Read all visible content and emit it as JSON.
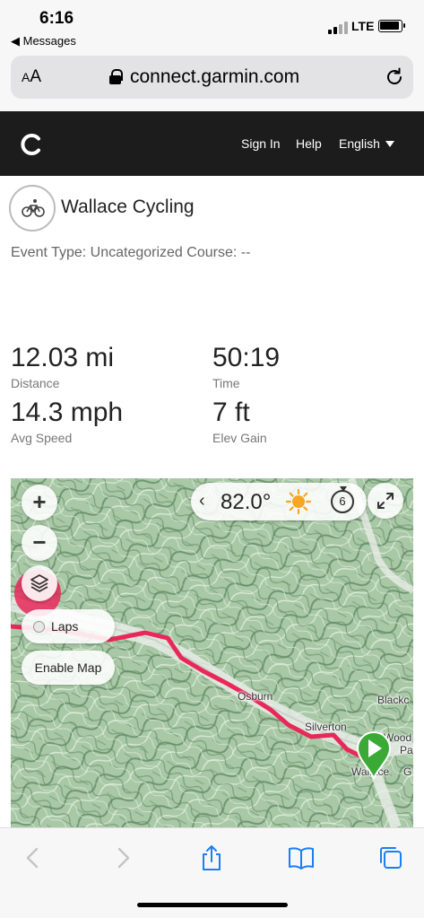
{
  "status_bar": {
    "time": "6:16",
    "back_app": "◀ Messages",
    "network": "LTE"
  },
  "browser": {
    "text_size_label": "AA",
    "domain": "connect.garmin.com",
    "icons": [
      "lock-icon",
      "reload-icon",
      "back-icon",
      "forward-icon",
      "share-icon",
      "bookmarks-icon",
      "tabs-icon"
    ]
  },
  "nav": {
    "signin": "Sign In",
    "help": "Help",
    "language": "English"
  },
  "activity": {
    "title": "Wallace Cycling",
    "event_type": "Event Type: Uncategorized Course: --",
    "icon": "bicycle-icon"
  },
  "stats": [
    {
      "value": "12.03 mi",
      "label": "Distance"
    },
    {
      "value": "50:19",
      "label": "Time"
    },
    {
      "value": "14.3 mph",
      "label": "Avg Speed"
    },
    {
      "value": "7 ft",
      "label": "Elev Gain"
    }
  ],
  "map": {
    "zoom_in": "+",
    "zoom_out": "−",
    "temperature": "82.0°",
    "wind_speed": "6",
    "laps_label": "Laps",
    "enable_map_label": "Enable Map",
    "places": [
      "Osburn",
      "Silverton",
      "Wallace",
      "Blackc",
      "Wood",
      "Pa",
      "G"
    ],
    "colors": {
      "route": "#e8285a",
      "start_pin": "#3aa935",
      "terrain": "#a9c9a8"
    }
  }
}
